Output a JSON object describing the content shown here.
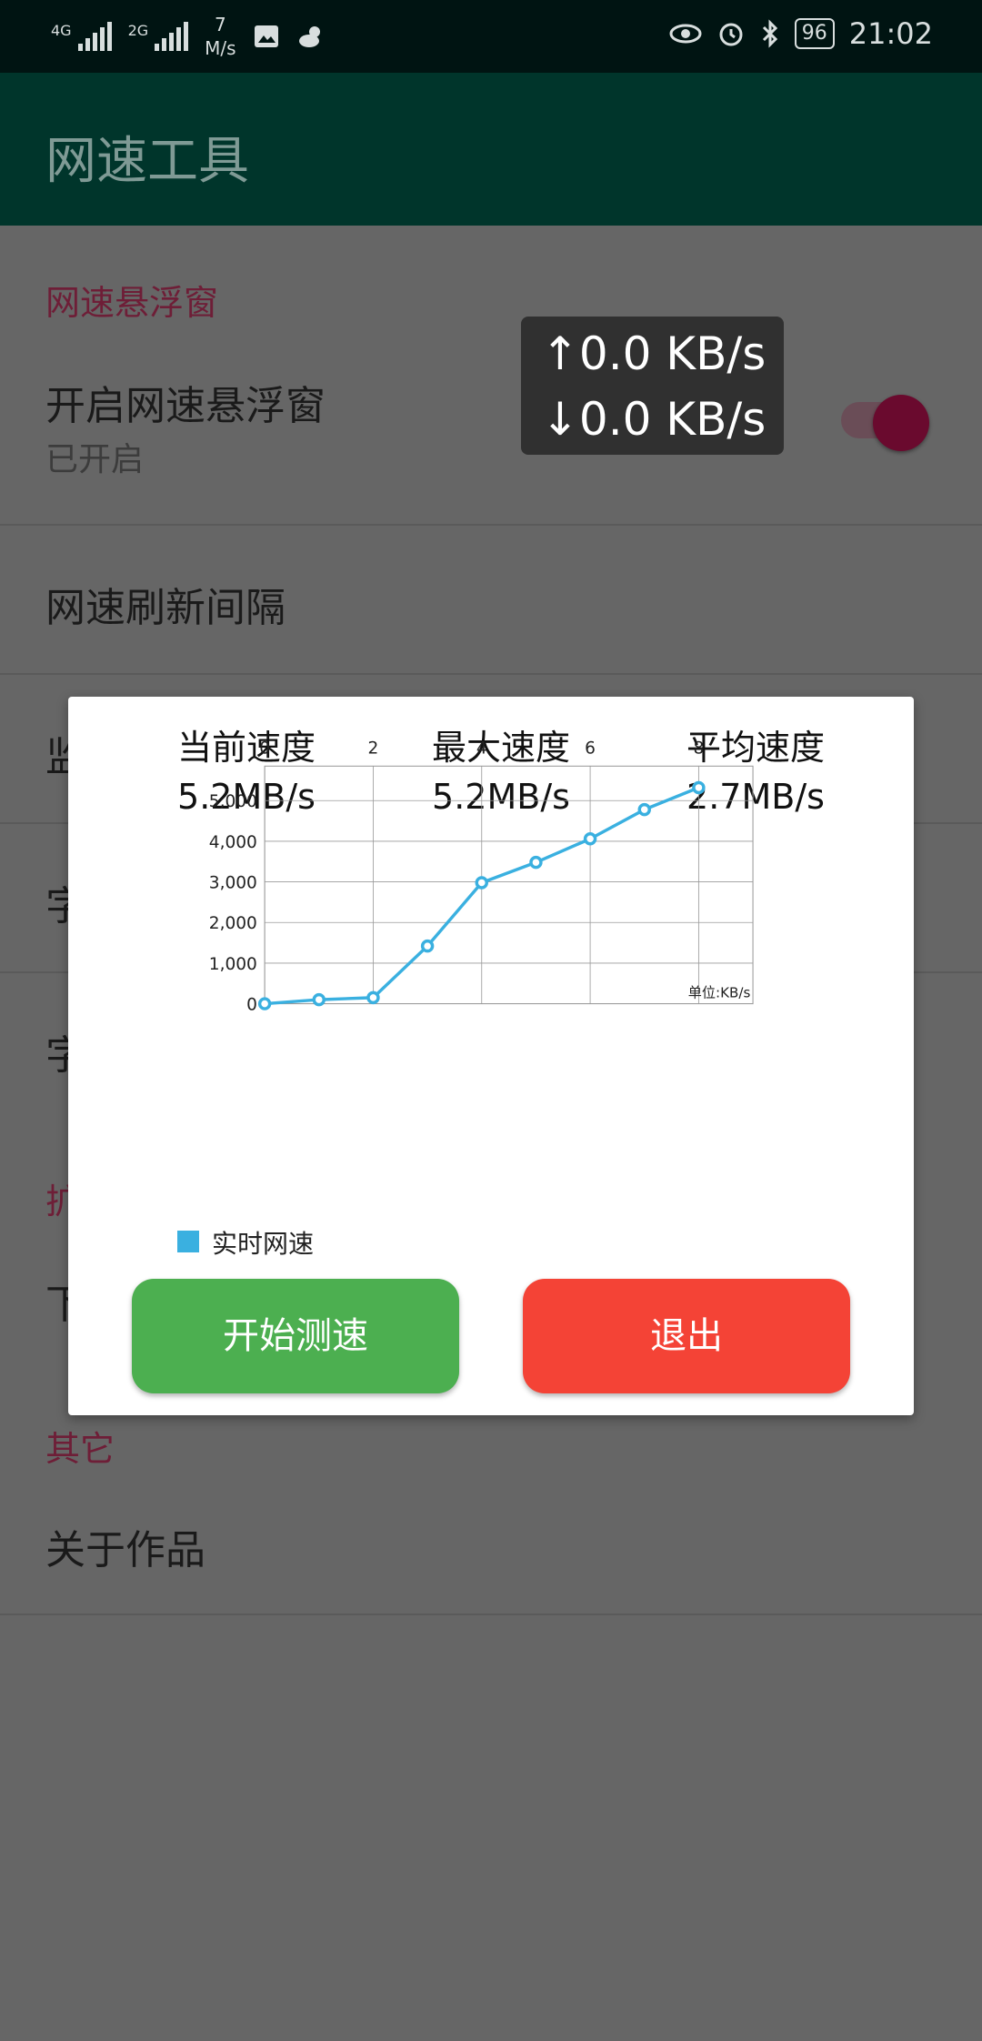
{
  "status_bar": {
    "sim1": "4G",
    "sim2": "2G",
    "net_speed_value": "7",
    "net_speed_unit": "M/s",
    "battery": "96",
    "time": "21:02"
  },
  "app_bar": {
    "title": "网速工具"
  },
  "settings": {
    "category_float": "网速悬浮窗",
    "float_toggle_title": "开启网速悬浮窗",
    "float_toggle_sub": "已开启",
    "float_toggle_on": true,
    "refresh_interval_title": "网速刷新间隔",
    "partial_row3": "监",
    "partial_row4": "字",
    "partial_row5": "字",
    "partial_category": "扩",
    "partial_row6": "下",
    "category_other": "其它",
    "about_title": "关于作品"
  },
  "floating_window": {
    "upload": "↑0.0 KB/s",
    "download": "↓0.0 KB/s"
  },
  "dialog": {
    "current_label": "当前速度",
    "current_value": "5.2MB/s",
    "max_label": "最大速度",
    "max_value": "5.2MB/s",
    "avg_label": "平均速度",
    "avg_value": "2.7MB/s",
    "start_button": "开始测速",
    "exit_button": "退出"
  },
  "chart_data": {
    "type": "line",
    "x": [
      0,
      1,
      2,
      3,
      4,
      5,
      6,
      7,
      8
    ],
    "series": [
      {
        "name": "实时网速",
        "values": [
          0,
          100,
          150,
          1420,
          2980,
          3480,
          4060,
          4780,
          5320
        ]
      }
    ],
    "x_ticks": [
      "0",
      "2",
      "4",
      "6",
      "8"
    ],
    "y_ticks": [
      "0",
      "1,000",
      "2,000",
      "3,000",
      "4,000",
      "5,000"
    ],
    "xlim": [
      0,
      9
    ],
    "ylim": [
      0,
      5850
    ],
    "unit_label": "单位:KB/s",
    "legend": "bottom-left",
    "grid": true,
    "color": "#3ab0e0"
  }
}
